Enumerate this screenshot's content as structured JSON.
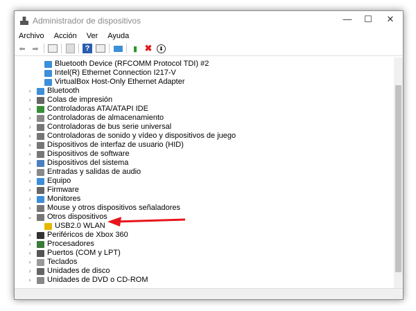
{
  "window": {
    "title": "Administrador de dispositivos",
    "minimize": "—",
    "maximize": "☐",
    "close": "✕"
  },
  "menu": [
    "Archivo",
    "Acción",
    "Ver",
    "Ayuda"
  ],
  "toolbar": [
    "back-icon",
    "forward-icon",
    "properties-icon",
    "update-icon",
    "help-icon",
    "view-icon",
    "monitor-icon",
    "add-driver-icon",
    "uninstall-icon",
    "disable-icon"
  ],
  "children_top": [
    "Bluetooth Device (RFCOMM Protocol TDI) #2",
    "Intel(R) Ethernet Connection I217-V",
    "VirtualBox Host-Only Ethernet Adapter"
  ],
  "categories": [
    "Bluetooth",
    "Colas de impresión",
    "Controladoras ATA/ATAPI IDE",
    "Controladoras de almacenamiento",
    "Controladoras de bus serie universal",
    "Controladoras de sonido y vídeo y dispositivos de juego",
    "Dispositivos de interfaz de usuario (HID)",
    "Dispositivos de software",
    "Dispositivos del sistema",
    "Entradas y salidas de audio",
    "Equipo",
    "Firmware",
    "Monitores",
    "Mouse y otros dispositivos señaladores",
    "Otros dispositivos"
  ],
  "other_child": "USB2.0 WLAN",
  "categories_after": [
    "Periféricos de Xbox 360",
    "Procesadores",
    "Puertos (COM y LPT)",
    "Teclados",
    "Unidades de disco",
    "Unidades de DVD o CD-ROM"
  ],
  "colors": {
    "arrow": "#e8141b"
  }
}
